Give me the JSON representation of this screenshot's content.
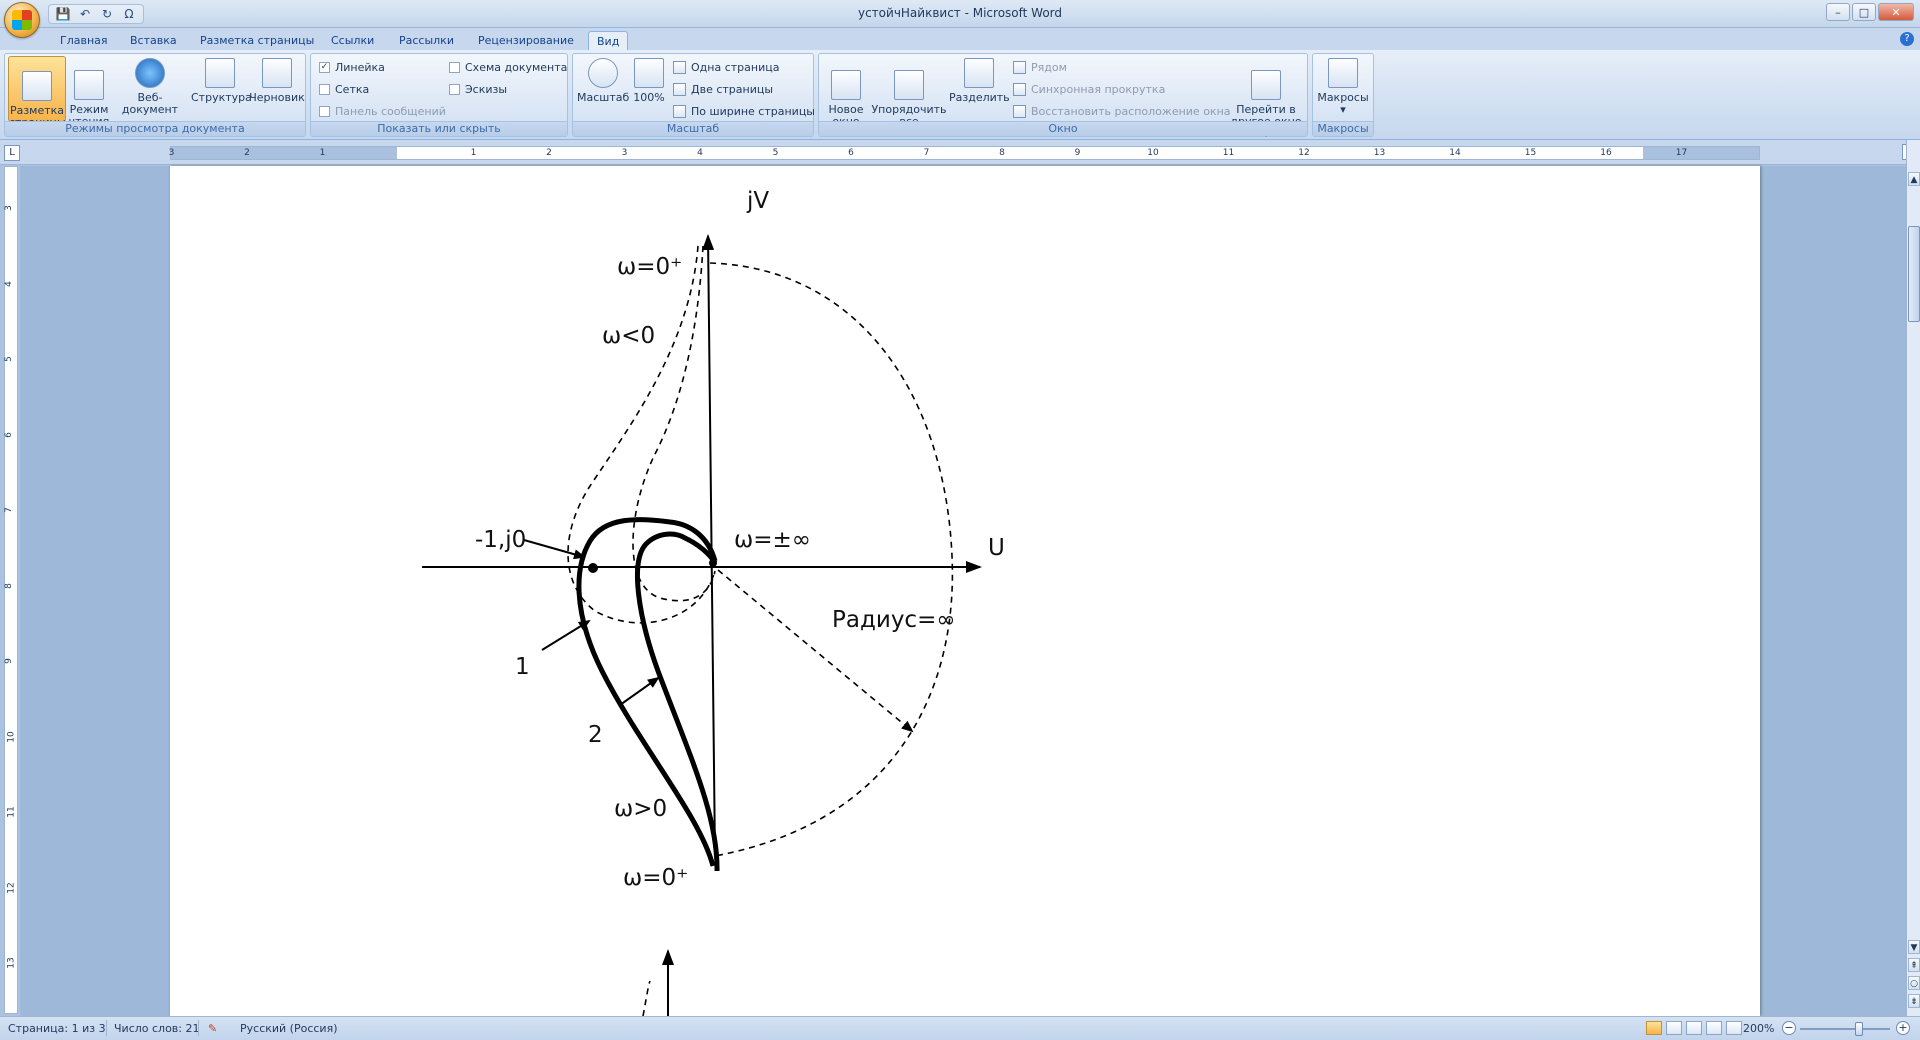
{
  "window": {
    "title": "устойчНайквист - Microsoft Word"
  },
  "qat": {
    "save": "💾",
    "undo": "↶",
    "redo": "↻",
    "symbol": "Ω"
  },
  "tabs": [
    "Главная",
    "Вставка",
    "Разметка страницы",
    "Ссылки",
    "Рассылки",
    "Рецензирование",
    "Вид"
  ],
  "active_tab": "Вид",
  "ribbon": {
    "views": {
      "label": "Режимы просмотра документа",
      "print_layout": "Разметка\nстраницы",
      "reading": "Режим\nчтения",
      "web": "Веб-документ",
      "outline": "Структура",
      "draft": "Черновик"
    },
    "show": {
      "label": "Показать или скрыть",
      "ruler": "Линейка",
      "gridlines": "Сетка",
      "message_bar": "Панель сообщений",
      "doc_map": "Схема документа",
      "thumbnails": "Эскизы",
      "ruler_checked": "✓"
    },
    "zoom": {
      "label": "Масштаб",
      "zoom": "Масштаб",
      "hundred": "100%",
      "one_page": "Одна страница",
      "two_pages": "Две страницы",
      "page_width": "По ширине страницы"
    },
    "window": {
      "label": "Окно",
      "new_window": "Новое\nокно",
      "arrange_all": "Упорядочить\nвсе",
      "split": "Разделить",
      "side_by_side": "Рядом",
      "sync_scroll": "Синхронная прокрутка",
      "reset_pos": "Восстановить расположение окна",
      "switch": "Перейти в\nдругое окно ▾"
    },
    "macros": {
      "label": "Макросы",
      "macros": "Макросы",
      "arrow": "▾"
    }
  },
  "ruler": {
    "corner": "L",
    "h_numbers": [
      "3",
      "2",
      "1",
      "1",
      "2",
      "3",
      "4",
      "5",
      "6",
      "7",
      "8",
      "9",
      "10",
      "11",
      "12",
      "13",
      "14",
      "15",
      "16",
      "17"
    ],
    "v_numbers": [
      "3",
      "4",
      "5",
      "6",
      "7",
      "8",
      "9",
      "10",
      "11",
      "12",
      "13"
    ]
  },
  "diagram": {
    "labels": {
      "jv": "jV",
      "u": "U",
      "w0_top": "ω=0⁺",
      "w_neg": "ω<0",
      "minus_one": "-1,j0",
      "w_inf": "ω=±∞",
      "radius": "Радиус=∞",
      "curve1": "1",
      "curve2": "2",
      "w_pos": "ω>0",
      "w0_bottom": "ω=0⁺"
    }
  },
  "statusbar": {
    "page": "Страница: 1 из 3",
    "words": "Число слов: 21",
    "language": "Русский (Россия)",
    "zoom": "200%",
    "zoom_minus": "−",
    "zoom_plus": "+"
  },
  "colors": {
    "accent": "#f8b34a",
    "ribbon": "#d2e0f2",
    "workspace": "#9eb8d9"
  }
}
